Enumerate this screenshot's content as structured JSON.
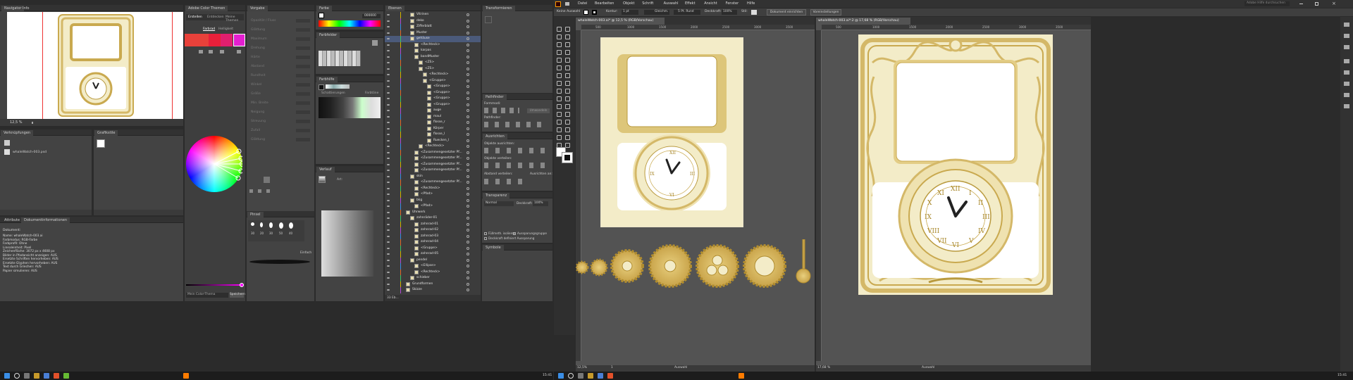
{
  "navigator": {
    "tabs": [
      "Navigator",
      "Info"
    ],
    "zoom": "12,5 %"
  },
  "color_themes": {
    "title": "Adobe Color Themen",
    "tabs": [
      "Erstellen",
      "Entdecken",
      "Meine Themen"
    ],
    "mode_left": "Farbrad",
    "mode_right": "Helligkeit",
    "swatches": [
      "#e8413a",
      "#e8413a",
      "#e8203a",
      "#e01f6e",
      "#e41fd1"
    ],
    "theme_name": "Mein Color-Thema",
    "save": "Speichern"
  },
  "presets": {
    "tab": "Vorgabe",
    "fields": [
      "Opazität / Fluss",
      "Glättung",
      "Maximum",
      "Drehung",
      "Härte",
      "Abstand",
      "Rundheit",
      "Winkel",
      "Größe",
      "Min. Breite",
      "Neigung",
      "Streuung",
      "Zufall",
      "Glättung"
    ]
  },
  "history": {
    "tabs": [
      "Verknüpfungen"
    ],
    "file": "whaleWatch-003.psd"
  },
  "doc_info": {
    "tabs": [
      "Attribute",
      "Dokumentinformationen"
    ],
    "heading": "Dokument:",
    "lines": [
      "Name: whaleWatch-003.ai",
      "Farbmodus: RGB-Farbe",
      "Farbprofil: Ohne",
      "Linealeinheit: Pixel",
      "Zeichenfläche: 3072 px x 4608 px",
      "Bilder in Pfadansicht anzeigen: AUS",
      "Ersetzte Schriften hervorheben: AUS",
      "Ersetzte Glyphen hervorheben: AUS",
      "Text durch Griechen: AUS",
      "Papier simulieren: AUS"
    ]
  },
  "swatches_small": {
    "tab": "Grafikstile"
  },
  "color": {
    "tab": "Farbe",
    "hex": "000000"
  },
  "swatch_panel": {
    "tab": "Farbfelder"
  },
  "gradient": {
    "tab": "Verlauf",
    "label": "Art:"
  },
  "color_guide": {
    "tab": "Farbhilfe",
    "left": "Schattierungen",
    "right": "Farbtöne"
  },
  "brushes": {
    "tab": "Pinsel",
    "sizes": [
      "30",
      "20",
      "30",
      "50",
      "40"
    ],
    "option": "Einfach"
  },
  "layers": {
    "tab": "Ebenen",
    "footer": "33 Eb...",
    "items": [
      {
        "name": "Vitrinen",
        "indent": 1
      },
      {
        "name": "deko",
        "indent": 1
      },
      {
        "name": "Zifferblatt",
        "indent": 1
      },
      {
        "name": "Muster",
        "indent": 1
      },
      {
        "name": "gehäuse",
        "indent": 1,
        "selected": true
      },
      {
        "name": "<Rechteck>",
        "indent": 2
      },
      {
        "name": "karpas",
        "indent": 2
      },
      {
        "name": "bandMuster",
        "indent": 2
      },
      {
        "name": "<ZS>",
        "indent": 3
      },
      {
        "name": "<ZS>",
        "indent": 3
      },
      {
        "name": "<Rechteck>",
        "indent": 4
      },
      {
        "name": "<Gruppe>",
        "indent": 4
      },
      {
        "name": "<Gruppe>",
        "indent": 5
      },
      {
        "name": "<Gruppe>",
        "indent": 5
      },
      {
        "name": "<Gruppe>",
        "indent": 5
      },
      {
        "name": "<Gruppe>",
        "indent": 5
      },
      {
        "name": "auge",
        "indent": 5
      },
      {
        "name": "maul",
        "indent": 5
      },
      {
        "name": "flosse_r",
        "indent": 5
      },
      {
        "name": "Körper",
        "indent": 5
      },
      {
        "name": "flosse_l",
        "indent": 5
      },
      {
        "name": "Ruecken_l",
        "indent": 5
      },
      {
        "name": "<Rechteck>",
        "indent": 3
      },
      {
        "name": "<Zusammengesetzter Pf...",
        "indent": 2
      },
      {
        "name": "<Zusammengesetzter Pf...",
        "indent": 2
      },
      {
        "name": "<Zusammengesetzter Pf...",
        "indent": 2
      },
      {
        "name": "<Zusammengesetzter Pf...",
        "indent": 2
      },
      {
        "name": "skin",
        "indent": 1
      },
      {
        "name": "<Zusammengesetzter Pf...",
        "indent": 2
      },
      {
        "name": "<Rechteck>",
        "indent": 2
      },
      {
        "name": "<Pfad>",
        "indent": 2
      },
      {
        "name": "bkg",
        "indent": 1
      },
      {
        "name": "<Pfad>",
        "indent": 2
      },
      {
        "name": "Uhrwerk",
        "indent": 0
      },
      {
        "name": "zahnräder-01",
        "indent": 1
      },
      {
        "name": "zahnrad-01",
        "indent": 2
      },
      {
        "name": "zahnrad-02",
        "indent": 2
      },
      {
        "name": "zahnrad-03",
        "indent": 2
      },
      {
        "name": "zahnrad-04",
        "indent": 2
      },
      {
        "name": "<Gruppe>",
        "indent": 2
      },
      {
        "name": "zahnrad-05",
        "indent": 2
      },
      {
        "name": "pendel",
        "indent": 1
      },
      {
        "name": "<Ellipse>",
        "indent": 2
      },
      {
        "name": "<Rechteck>",
        "indent": 2
      },
      {
        "name": "schieber",
        "indent": 1
      },
      {
        "name": "Grundformen",
        "indent": 0
      },
      {
        "name": "Skizze",
        "indent": 0
      }
    ]
  },
  "transform": {
    "tab": "Transformieren"
  },
  "pathfinder": {
    "tab": "Pathfinder",
    "label1": "Formmodi:",
    "label2": "Pathfinder:",
    "btn": "Umwandeln"
  },
  "align": {
    "tab": "Ausrichten",
    "label1": "Objekte ausrichten:",
    "label2": "Objekte verteilen:",
    "label3": "Abstand verteilen:",
    "label4": "Ausrichten an:"
  },
  "transparency": {
    "tab": "Transparenz",
    "mode": "Normal",
    "opacity_label": "Deckkraft:",
    "opacity": "100%",
    "cb1": "Füllmeth. isolieren",
    "cb2": "Aussparungsgruppe",
    "cb3": "Deckkraft definiert Aussparung"
  },
  "symbols": {
    "tab": "Symbole"
  },
  "menubar": {
    "items": [
      "Datei",
      "Bearbeiten",
      "Objekt",
      "Schrift",
      "Auswahl",
      "Effekt",
      "Ansicht",
      "Fenster",
      "Hilfe"
    ],
    "search": "Adobe Hilfe durchsuchen"
  },
  "controlbar": {
    "label": "Keine Auswahl",
    "stroke_label": "Kontur:",
    "stroke_value": "1 pt",
    "line": "Gleichm.",
    "brush": "5 Pt. Rund",
    "opacity_label": "Deckkraft:",
    "opacity": "100%",
    "style_label": "Stil:",
    "btn1": "Dokument einrichten",
    "btn2": "Voreinstellungen"
  },
  "doc1": {
    "tab": "whaleWatch-003.ai* @ 12,5 % (RGB/Vorschau)",
    "zoom": "12,5%",
    "page": "1",
    "status": "Auswahl"
  },
  "doc2": {
    "tab": "whaleWatch-003.ai*:2 @ 17,68 % (RGB/Vorschau)",
    "zoom": "17,68 %",
    "status": "Auswahl"
  },
  "ruler_labels": [
    "500",
    "1000",
    "1500",
    "2000",
    "2500",
    "3000",
    "3500"
  ],
  "taskbar": {
    "time_left": "15:41",
    "time_right": "15:41"
  },
  "colors": {
    "card": "#f3ecc8",
    "gold": "#d4b868",
    "gold_dark": "#b99a3e",
    "accent": "#2d8cf0"
  }
}
